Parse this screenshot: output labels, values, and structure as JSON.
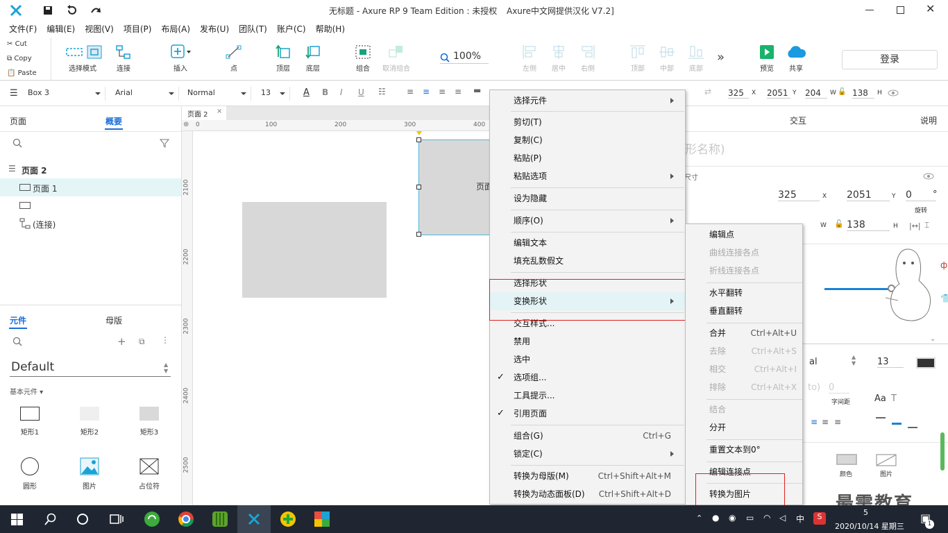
{
  "window": {
    "title": "无标题 - Axure RP 9 Team Edition : 未授权",
    "title_extra": "Axure中文网提供汉化 V7.2]"
  },
  "menu": [
    "文件(F)",
    "编辑(E)",
    "视图(V)",
    "项目(P)",
    "布局(A)",
    "发布(U)",
    "团队(T)",
    "账户(C)",
    "帮助(H)"
  ],
  "clipboard": {
    "cut": "Cut",
    "copy": "Copy",
    "paste": "Paste"
  },
  "toolbar": {
    "select_mode": "选择模式",
    "connect": "连接",
    "insert": "插入",
    "point": "点",
    "top_layer": "顶层",
    "bottom_layer": "底层",
    "group": "组合",
    "ungroup": "取消组合",
    "zoom": "100%",
    "align_left": "左侧",
    "align_center": "居中",
    "align_right": "右侧",
    "align_top": "顶部",
    "align_middle": "中部",
    "align_bottom": "底部",
    "preview": "预览",
    "share": "共享",
    "login": "登录"
  },
  "format": {
    "element": "Box 3",
    "font": "Arial",
    "style": "Normal",
    "size": "13",
    "x": "325",
    "y": "2051",
    "w": "204",
    "h": "138",
    "x_label": "X",
    "y_label": "Y",
    "w_label": "W",
    "h_label": "H"
  },
  "left_panel": {
    "tab_pages": "页面",
    "tab_outline": "概要",
    "tree": [
      "页面 2",
      "页面 1",
      "(连接)"
    ],
    "tab_widgets": "元件",
    "tab_masters": "母版",
    "library": "Default",
    "category": "基本元件 ▾",
    "widgets": [
      "矩形1",
      "矩形2",
      "矩形3",
      "圆形",
      "图片",
      "占位符"
    ]
  },
  "canvas": {
    "tab": "页面 2",
    "ruler_top": [
      "0",
      "100",
      "200",
      "300",
      "400"
    ],
    "ruler_left": [
      "2100",
      "2200",
      "2300",
      "2400",
      "2500"
    ],
    "shape_text": "页面"
  },
  "right_panel": {
    "tab_interact": "交互",
    "tab_notes": "说明",
    "name_placeholder": "形名称)",
    "size_label": "尺寸",
    "x": "325",
    "y": "2051",
    "rotation": "0",
    "degree": "°",
    "rotation_label": "旋转",
    "w": "204",
    "h": "138",
    "font_tail": "al",
    "font_size": "13",
    "auto": "to)",
    "spacing": "0",
    "spacing_label": "字间距",
    "fill_label": "颜色",
    "image_label": "图片",
    "watermark": "最需教育"
  },
  "context_menu": {
    "items": [
      {
        "label": "选择元件",
        "sub": true
      },
      {
        "label": "剪切(T)"
      },
      {
        "label": "复制(C)"
      },
      {
        "label": "粘贴(P)"
      },
      {
        "label": "粘贴选项",
        "sub": true
      },
      {
        "label": "设为隐藏"
      },
      {
        "label": "顺序(O)",
        "sub": true
      },
      {
        "label": "编辑文本"
      },
      {
        "label": "填充乱数假文"
      },
      {
        "label": "选择形状"
      },
      {
        "label": "变换形状",
        "sub": true
      },
      {
        "label": "交互样式..."
      },
      {
        "label": "禁用"
      },
      {
        "label": "选中"
      },
      {
        "label": "选项组...",
        "checked": true
      },
      {
        "label": "工具提示..."
      },
      {
        "label": "引用页面",
        "checked": true
      },
      {
        "label": "组合(G)",
        "shortcut": "Ctrl+G"
      },
      {
        "label": "锁定(C)",
        "sub": true
      },
      {
        "label": "转换为母版(M)",
        "shortcut": "Ctrl+Shift+Alt+M"
      },
      {
        "label": "转换为动态面板(D)",
        "shortcut": "Ctrl+Shift+Alt+D"
      }
    ]
  },
  "submenu": {
    "items": [
      {
        "label": "编辑点"
      },
      {
        "label": "曲线连接各点",
        "disabled": true
      },
      {
        "label": "折线连接各点",
        "disabled": true
      },
      {
        "label": "水平翻转"
      },
      {
        "label": "垂直翻转"
      },
      {
        "label": "合并",
        "shortcut": "Ctrl+Alt+U"
      },
      {
        "label": "去除",
        "shortcut": "Ctrl+Alt+S",
        "disabled": true
      },
      {
        "label": "相交",
        "shortcut": "Ctrl+Alt+I",
        "disabled": true
      },
      {
        "label": "排除",
        "shortcut": "Ctrl+Alt+X",
        "disabled": true
      },
      {
        "label": "结合",
        "disabled": true
      },
      {
        "label": "分开"
      },
      {
        "label": "重置文本到0°"
      },
      {
        "label": "编辑连接点"
      },
      {
        "label": "转换为图片"
      }
    ]
  },
  "taskbar": {
    "time_partial": "5",
    "date": "2020/10/14 星期三",
    "ime": "中",
    "notif": "1"
  },
  "colors": {
    "accent": "#1aa3d5",
    "highlight_box": "#e02020",
    "taskbar": "#1f2631"
  }
}
